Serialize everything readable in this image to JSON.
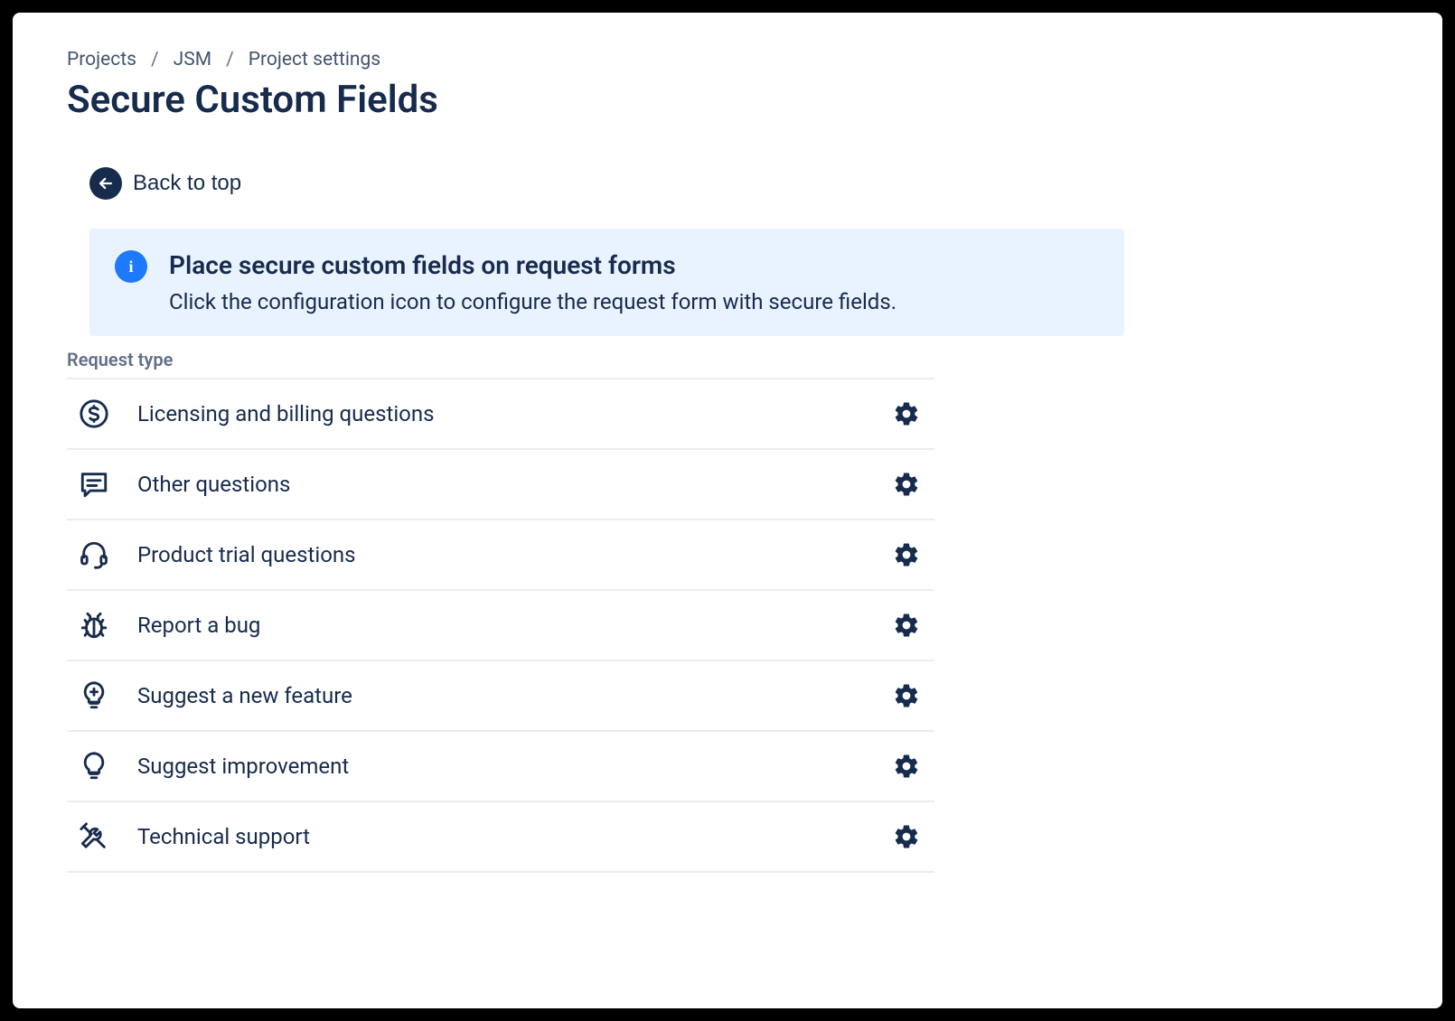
{
  "breadcrumb": {
    "items": [
      "Projects",
      "JSM",
      "Project settings"
    ]
  },
  "page_title": "Secure Custom Fields",
  "back_link_label": "Back to top",
  "info": {
    "title": "Place secure custom fields on request forms",
    "body": "Click the configuration icon to configure the request form with secure fields."
  },
  "section_label": "Request type",
  "request_types": [
    {
      "icon": "dollar-circle-icon",
      "label": "Licensing and billing questions"
    },
    {
      "icon": "comment-icon",
      "label": "Other questions"
    },
    {
      "icon": "headset-icon",
      "label": "Product trial questions"
    },
    {
      "icon": "bug-icon",
      "label": "Report a bug"
    },
    {
      "icon": "lightbulb-plus-icon",
      "label": "Suggest a new feature"
    },
    {
      "icon": "lightbulb-icon",
      "label": "Suggest improvement"
    },
    {
      "icon": "tools-icon",
      "label": "Technical support"
    }
  ]
}
